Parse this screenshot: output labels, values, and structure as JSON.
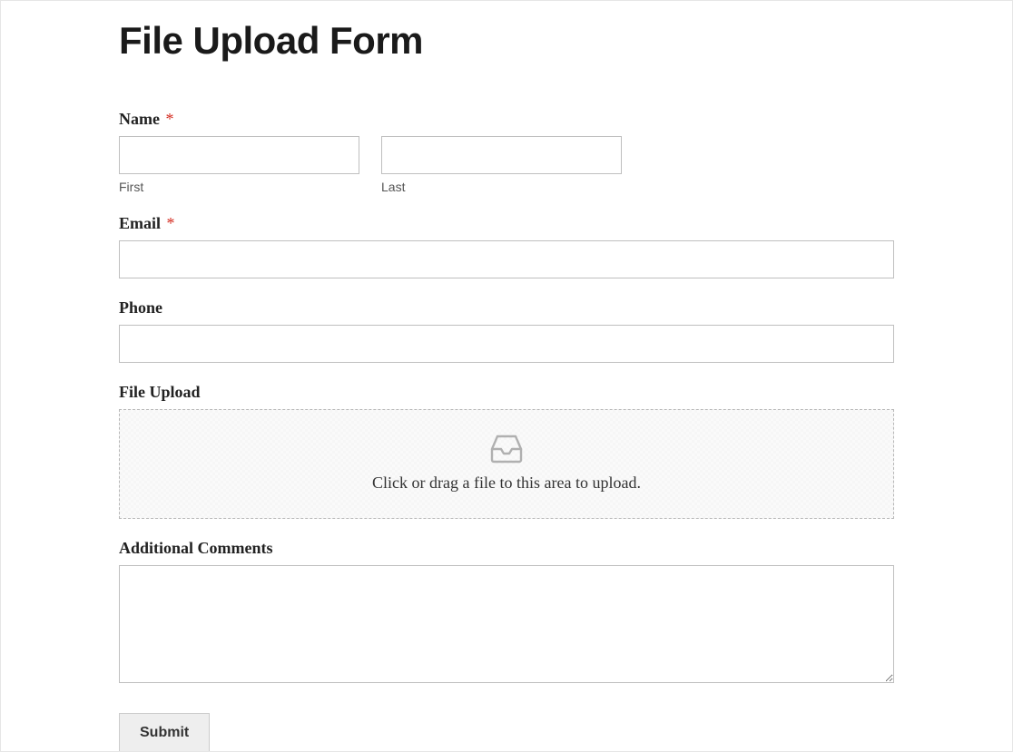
{
  "title": "File Upload Form",
  "required_marker": "*",
  "fields": {
    "name": {
      "label": "Name",
      "required": true,
      "first_sublabel": "First",
      "last_sublabel": "Last",
      "first_value": "",
      "last_value": ""
    },
    "email": {
      "label": "Email",
      "required": true,
      "value": ""
    },
    "phone": {
      "label": "Phone",
      "required": false,
      "value": ""
    },
    "file_upload": {
      "label": "File Upload",
      "dropzone_text": "Click or drag a file to this area to upload.",
      "icon": "inbox-icon"
    },
    "comments": {
      "label": "Additional Comments",
      "value": ""
    }
  },
  "submit_label": "Submit"
}
